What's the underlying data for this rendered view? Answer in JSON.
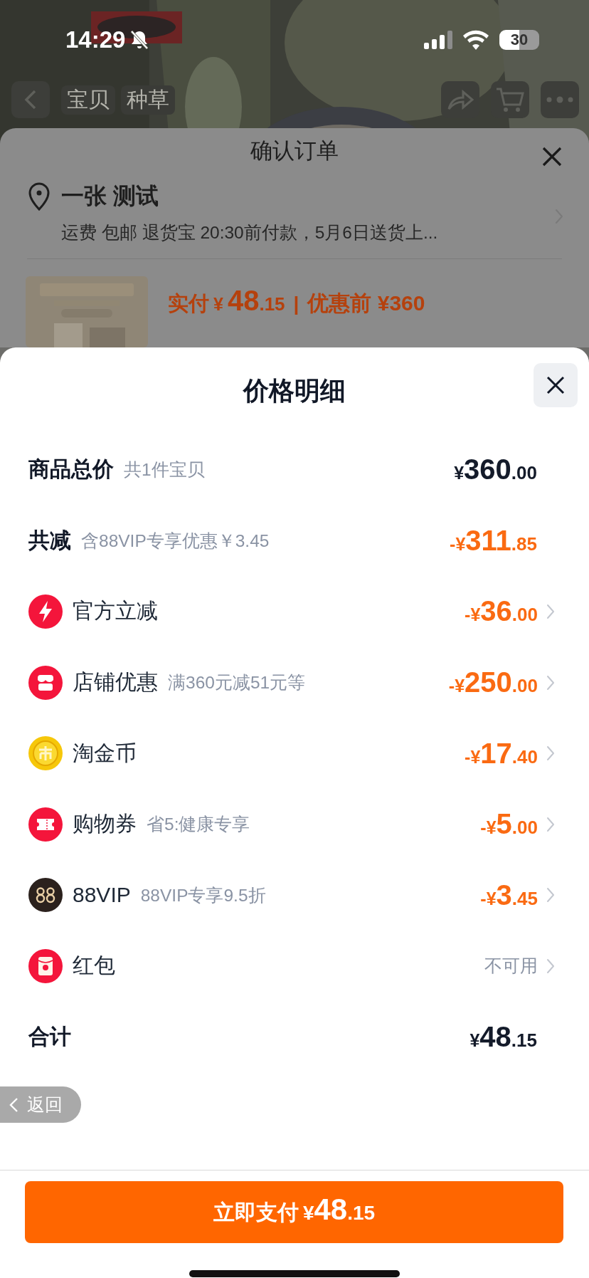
{
  "status_bar": {
    "time": "14:29",
    "battery": "30"
  },
  "nav": {
    "tabs": [
      "宝贝",
      "种草"
    ]
  },
  "order_sheet": {
    "title": "确认订单",
    "address": {
      "name": "一张 测试",
      "details": "运费 包邮 退货宝 20:30前付款，5月6日送货上..."
    },
    "product": {
      "paid_label": "实付",
      "paid_price": {
        "currency": "¥",
        "whole": "48",
        "fraction": ".15"
      },
      "separator": "|",
      "original_price": "优惠前 ¥360"
    }
  },
  "price_detail": {
    "title": "价格明细",
    "rows": [
      {
        "kind": "subtotal",
        "label": "商品总价",
        "note": "共1件宝贝",
        "amount": {
          "currency": "¥",
          "whole": "360",
          "fraction": ".00"
        }
      },
      {
        "kind": "discount_total",
        "label": "共减",
        "note": "含88VIP专享优惠￥3.45",
        "amount": {
          "currency": "-¥",
          "whole": "311",
          "fraction": ".85"
        }
      },
      {
        "kind": "discount",
        "label": "官方立减",
        "amount": {
          "currency": "-¥",
          "whole": "36",
          "fraction": ".00"
        }
      },
      {
        "kind": "discount",
        "label": "店铺优惠",
        "note": "满360元减51元等",
        "amount": {
          "currency": "-¥",
          "whole": "250",
          "fraction": ".00"
        }
      },
      {
        "kind": "discount",
        "label": "淘金币",
        "amount": {
          "currency": "-¥",
          "whole": "17",
          "fraction": ".40"
        }
      },
      {
        "kind": "discount",
        "label": "购物券",
        "note": "省5:健康专享",
        "amount": {
          "currency": "-¥",
          "whole": "5",
          "fraction": ".00"
        }
      },
      {
        "kind": "discount",
        "label": "88VIP",
        "note": "88VIP专享9.5折",
        "amount": {
          "currency": "-¥",
          "whole": "3",
          "fraction": ".45"
        }
      },
      {
        "kind": "unavailable",
        "label": "红包",
        "status": "不可用"
      },
      {
        "kind": "total",
        "label": "合计",
        "amount": {
          "currency": "¥",
          "whole": "48",
          "fraction": ".15"
        }
      }
    ],
    "back_button": "返回",
    "pay_button": {
      "label": "立即支付",
      "price": {
        "currency": "¥",
        "whole": "48",
        "fraction": ".15"
      }
    }
  }
}
